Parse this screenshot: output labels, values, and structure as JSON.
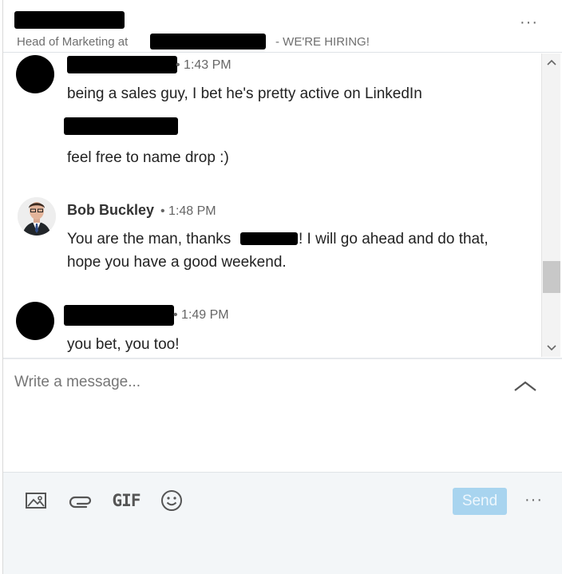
{
  "header": {
    "subtitle_prefix": "Head of Marketing at",
    "subtitle_suffix": "- WE'RE HIRING!",
    "more_icon": "more-horizontal-icon",
    "more_label": "···"
  },
  "messages": [
    {
      "sender": "",
      "time": "• 1:43 PM",
      "lines": [
        "being a sales guy, I bet he's pretty active on LinkedIn"
      ]
    },
    {
      "sender": "",
      "time": "",
      "lines": [
        "feel free to name drop :)"
      ]
    },
    {
      "sender": "Bob Buckley",
      "time": "• 1:48 PM",
      "lines": [
        "You are the man, thanks",
        "! I will go ahead and do that,",
        "hope you have a good weekend."
      ]
    },
    {
      "sender": "",
      "time": "• 1:49 PM",
      "lines": [
        "you bet, you too!"
      ]
    }
  ],
  "scrollbar": {
    "up_icon": "chevron-up-icon",
    "up_glyph": "^",
    "down_icon": "chevron-down-icon",
    "down_glyph": "⌄"
  },
  "compose": {
    "placeholder": "Write a message...",
    "expand_icon": "chevron-up-icon"
  },
  "toolbar": {
    "image_icon": "image-icon",
    "attach_icon": "paperclip-icon",
    "gif_label": "GIF",
    "emoji_icon": "emoji-icon",
    "send_label": "Send",
    "more_label": "···",
    "send_color": "#a8d4ef"
  }
}
